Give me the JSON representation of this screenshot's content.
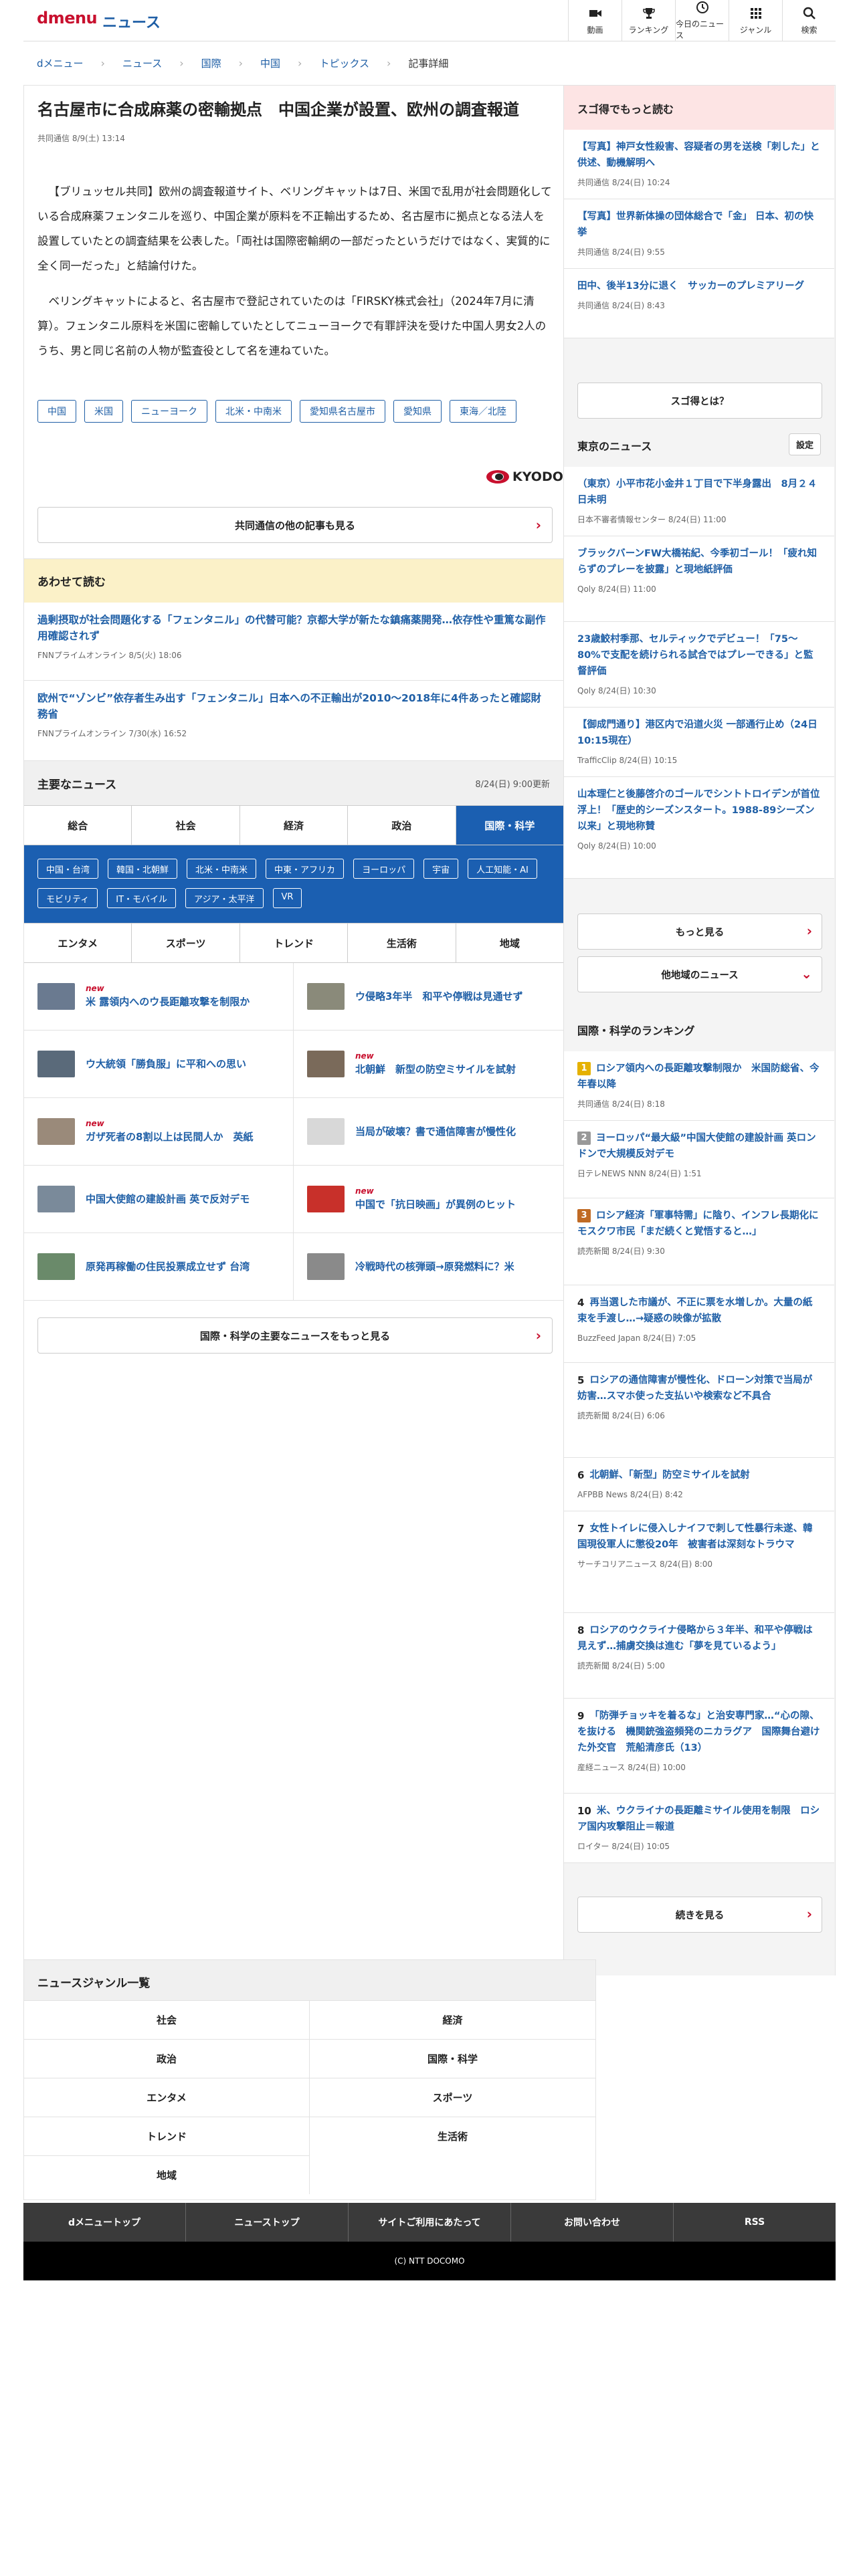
{
  "header": {
    "logo": "dmenu",
    "site_title": "ニュース",
    "nav": [
      {
        "label": "動画",
        "icon": "video-icon"
      },
      {
        "label": "ランキング",
        "icon": "trophy-icon"
      },
      {
        "label": "今日のニュース",
        "icon": "clock-icon"
      },
      {
        "label": "ジャンル",
        "icon": "grid-icon"
      },
      {
        "label": "検索",
        "icon": "search-icon"
      }
    ]
  },
  "breadcrumb": [
    "dメニュー",
    "ニュース",
    "国際",
    "中国",
    "トピックス",
    "記事詳細"
  ],
  "article": {
    "title": "名古屋市に合成麻薬の密輸拠点　中国企業が設置、欧州の調査報道",
    "meta": "共同通信 8/9(土) 13:14",
    "paragraphs": [
      "【ブリュッセル共同】欧州の調査報道サイト、ベリングキャットは7日、米国で乱用が社会問題化している合成麻薬フェンタニルを巡り、中国企業が原料を不正輸出するため、名古屋市に拠点となる法人を設置していたとの調査結果を公表した。「両社は国際密輸網の一部だったというだけではなく、実質的に全く同一だった」と結論付けた。",
      "ベリングキャットによると、名古屋市で登記されていたのは「FIRSKY株式会社」（2024年7月に清算）。フェンタニル原料を米国に密輸していたとしてニューヨークで有罪評決を受けた中国人男女2人のうち、男と同じ名前の人物が監査役として名を連ねていた。"
    ],
    "tags": [
      "中国",
      "米国",
      "ニューヨーク",
      "北米・中南米",
      "愛知県名古屋市",
      "愛知県",
      "東海／北陸"
    ],
    "source_logo": "KYODO",
    "more_button": "共同通信の他の記事も見る"
  },
  "related": {
    "heading": "あわせて読む",
    "items": [
      {
        "title": "過剰摂取が社会問題化する「フェンタニル」の代替可能？京都大学が新たな鎮痛薬開発…依存性や重篤な副作用確認されず",
        "meta": "FNNプライムオンライン 8/5(火) 18:06"
      },
      {
        "title": "欧州で“ゾンビ”依存者生み出す「フェンタニル」日本への不正輸出が2010～2018年に4件あったと確認財務省",
        "meta": "FNNプライムオンライン 7/30(水) 16:52"
      }
    ]
  },
  "main_news": {
    "heading": "主要なニュース",
    "updated": "8/24(日) 9:00更新",
    "tabs_row1": [
      {
        "label": "総合",
        "active": false
      },
      {
        "label": "社会",
        "active": false
      },
      {
        "label": "経済",
        "active": false
      },
      {
        "label": "政治",
        "active": false
      },
      {
        "label": "国際・科学",
        "active": true
      }
    ],
    "subcategories": [
      "中国・台湾",
      "韓国・北朝鮮",
      "北米・中南米",
      "中東・アフリカ",
      "ヨーロッパ",
      "宇宙",
      "人工知能・AI",
      "モビリティ",
      "IT・モバイル",
      "アジア・太平洋",
      "VR"
    ],
    "tabs_row2": [
      "エンタメ",
      "スポーツ",
      "トレンド",
      "生活術",
      "地域"
    ],
    "new_label": "new",
    "items": [
      {
        "title": "米 露領内へのウ長距離攻撃を制限か",
        "new": true,
        "thumb": "#6a7a90"
      },
      {
        "title": "ウ侵略3年半　和平や停戦は見通せず",
        "new": false,
        "thumb": "#8a8a7a"
      },
      {
        "title": "ウ大統領「勝負服」に平和への思い",
        "new": false,
        "thumb": "#5a6a7a"
      },
      {
        "title": "北朝鮮　新型の防空ミサイルを試射",
        "new": true,
        "thumb": "#7a6a5a"
      },
      {
        "title": "ガザ死者の8割以上は民間人か　英紙",
        "new": true,
        "thumb": "#9a8a7a"
      },
      {
        "title": "当局が破壊？書で通信障害が慢性化",
        "new": false,
        "thumb": "#d8d8d8"
      },
      {
        "title": "中国大使館の建設計画 英で反対デモ",
        "new": false,
        "thumb": "#7a8a9a"
      },
      {
        "title": "中国で「抗日映画」が異例のヒット",
        "new": true,
        "thumb": "#c8302a"
      },
      {
        "title": "原発再稼働の住民投票成立せず 台湾",
        "new": false,
        "thumb": "#6a8a6a"
      },
      {
        "title": "冷戦時代の核弾頭→原発燃料に？米",
        "new": false,
        "thumb": "#8a8a8a"
      }
    ],
    "more_button": "国際・科学の主要なニュースをもっと見る"
  },
  "genres": {
    "heading": "ニュースジャンル一覧",
    "items": [
      "社会",
      "経済",
      "政治",
      "国際・科学",
      "エンタメ",
      "スポーツ",
      "トレンド",
      "生活術",
      "地域"
    ]
  },
  "footer": {
    "links": [
      "dメニュートップ",
      "ニューストップ",
      "サイトご利用にあたって",
      "お問い合わせ",
      "RSS"
    ],
    "copyright": "(C) NTT DOCOMO"
  },
  "sidebar": {
    "sugotoku": {
      "heading": "スゴ得でもっと読む",
      "items": [
        {
          "title": "【写真】神戸女性殺害、容疑者の男を送検「刺した」と供述、動機解明へ",
          "meta": "共同通信 8/24(日) 10:24"
        },
        {
          "title": "【写真】世界新体操の団体総合で「金」 日本、初の快挙",
          "meta": "共同通信 8/24(日) 9:55"
        },
        {
          "title": "田中、後半13分に退く　サッカーのプレミアリーグ",
          "meta": "共同通信 8/24(日) 8:43"
        }
      ],
      "button": "スゴ得とは？"
    },
    "tokyo": {
      "heading": "東京のニュース",
      "settings": "設定",
      "items": [
        {
          "title": "（東京）小平市花小金井１丁目で下半身露出　8月２４日未明",
          "meta": "日本不審者情報センター 8/24(日) 11:00"
        },
        {
          "title": "ブラックバーンFW大橋祐紀、今季初ゴール！「疲れ知らずのプレーを披露」と現地紙評価",
          "meta": "Qoly 8/24(日) 11:00"
        },
        {
          "title": "23歳鮫村季那、セルティックでデビュー！「75～80%で支配を続けられる試合ではプレーできる」と監督評価",
          "meta": "Qoly 8/24(日) 10:30"
        },
        {
          "title": "【御成門通り】港区内で沿道火災 一部通行止め（24日10:15現在）",
          "meta": "TrafficClip 8/24(日) 10:15"
        },
        {
          "title": "山本理仁と後藤啓介のゴールでシントトロイデンが首位浮上！「歴史的シーズンスタート。1988-89シーズン以来」と現地称賛",
          "meta": "Qoly 8/24(日) 10:00"
        }
      ],
      "more_button": "もっと見る",
      "other_button": "他地域のニュース"
    },
    "ranking": {
      "heading": "国際・科学のランキング",
      "items": [
        {
          "rank": "1",
          "title": "ロシア領内への長距離攻撃制限か　米国防総省、今年春以降",
          "meta": "共同通信 8/24(日) 8:18"
        },
        {
          "rank": "2",
          "title": "ヨーロッパ“最大級”中国大使館の建設計画 英ロンドンで大規模反対デモ",
          "meta": "日テレNEWS NNN 8/24(日) 1:51"
        },
        {
          "rank": "3",
          "title": "ロシア経済「軍事特需」に陰り、インフレ長期化にモスクワ市民「まだ続くと覚悟すると…」",
          "meta": "読売新聞 8/24(日) 9:30"
        },
        {
          "rank": "4",
          "title": "再当選した市議が、不正に票を水増しか。大量の紙束を手渡し…→疑惑の映像が拡散",
          "meta": "BuzzFeed Japan 8/24(日) 7:05"
        },
        {
          "rank": "5",
          "title": "ロシアの通信障害が慢性化、ドローン対策で当局が妨害…スマホ使った支払いや検索など不具合",
          "meta": "読売新聞 8/24(日) 6:06"
        },
        {
          "rank": "6",
          "title": "北朝鮮、「新型」防空ミサイルを試射",
          "meta": "AFPBB News 8/24(日) 8:42"
        },
        {
          "rank": "7",
          "title": "女性トイレに侵入しナイフで刺して性暴行未遂、韓国現役軍人に懲役20年　被害者は深刻なトラウマ",
          "meta": "サーチコリアニュース 8/24(日) 8:00"
        },
        {
          "rank": "8",
          "title": "ロシアのウクライナ侵略から３年半、和平や停戦は見えず…捕虜交換は進む「夢を見ているよう」",
          "meta": "読売新聞 8/24(日) 5:00"
        },
        {
          "rank": "9",
          "title": "「防弾チョッキを着るな」と治安専門家…“心の隙、を抜ける　機関銃強盗頻発のニカラグア　国際舞台避けた外交官　荒船清彦氏（13）",
          "meta": "産経ニュース 8/24(日) 10:00"
        },
        {
          "rank": "10",
          "title": "米、ウクライナの長距離ミサイル使用を制限　ロシア国内攻撃阻止＝報道",
          "meta": "ロイター 8/24(日) 10:05"
        }
      ],
      "more_button": "続きを見る"
    }
  }
}
